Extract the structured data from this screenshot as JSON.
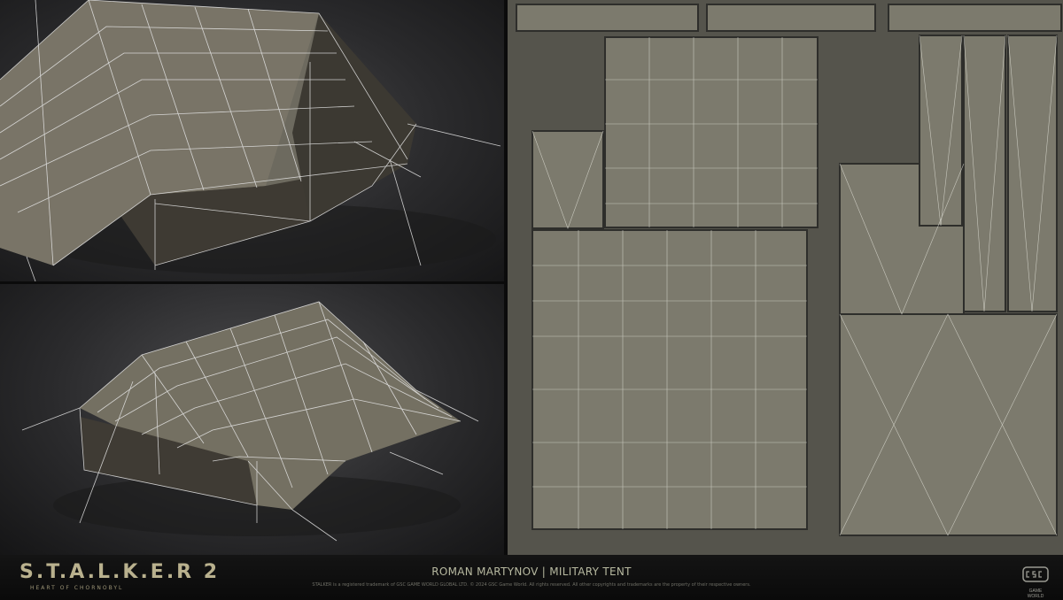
{
  "footer": {
    "logo_title": "S.T.A.L.K.E.R 2",
    "logo_subtitle": "HEART OF CHORNOBYL",
    "credit": "ROMAN MARTYNOV | MILITARY TENT",
    "legal": "STALKER is a registered trademark of GSC GAME WORLD GLOBAL LTD. © 2024 GSC Game World. All rights reserved. All other copyrights and trademarks are the property of their respective owners.",
    "studio_name": "GAME WORLD"
  },
  "colors": {
    "background": "#0d0d0d",
    "canvas": "#7c7a6d",
    "wire": "#e6e6e6",
    "logo": "#b9b18e"
  }
}
